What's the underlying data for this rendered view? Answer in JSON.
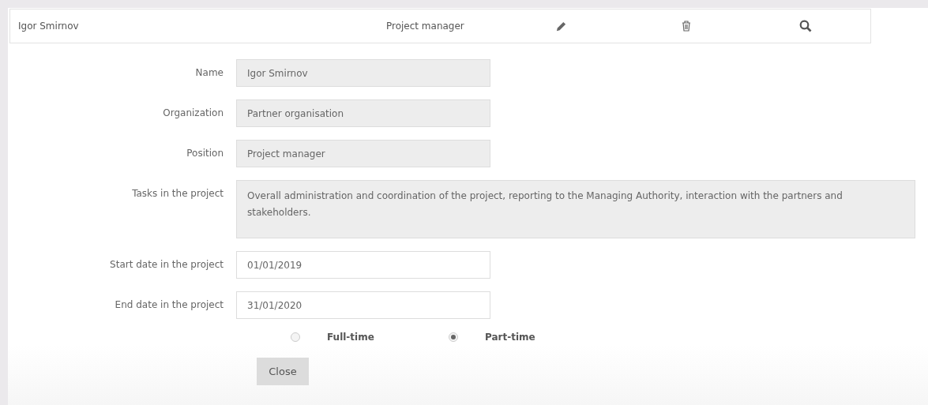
{
  "row": {
    "name": "Igor Smirnov",
    "position": "Project manager"
  },
  "fields": [
    {
      "label": "Name",
      "value": "Igor Smirnov",
      "disabled": true,
      "kind": "input"
    },
    {
      "label": "Organization",
      "value": "Partner organisation",
      "disabled": true,
      "kind": "input"
    },
    {
      "label": "Position",
      "value": "Project manager",
      "disabled": true,
      "kind": "input"
    },
    {
      "label": "Tasks in the project",
      "value": "Overall administration and coordination of the project, reporting to the Managing Authority, interaction with the partners and stakeholders.",
      "disabled": true,
      "kind": "textarea"
    },
    {
      "label": "Start date in the project",
      "value": "01/01/2019",
      "disabled": false,
      "kind": "input"
    },
    {
      "label": "End date in the project",
      "value": "31/01/2020",
      "disabled": false,
      "kind": "input"
    }
  ],
  "employment": [
    {
      "label": "Full-time",
      "selected": false
    },
    {
      "label": "Part-time",
      "selected": true
    }
  ],
  "close_button": "Close"
}
